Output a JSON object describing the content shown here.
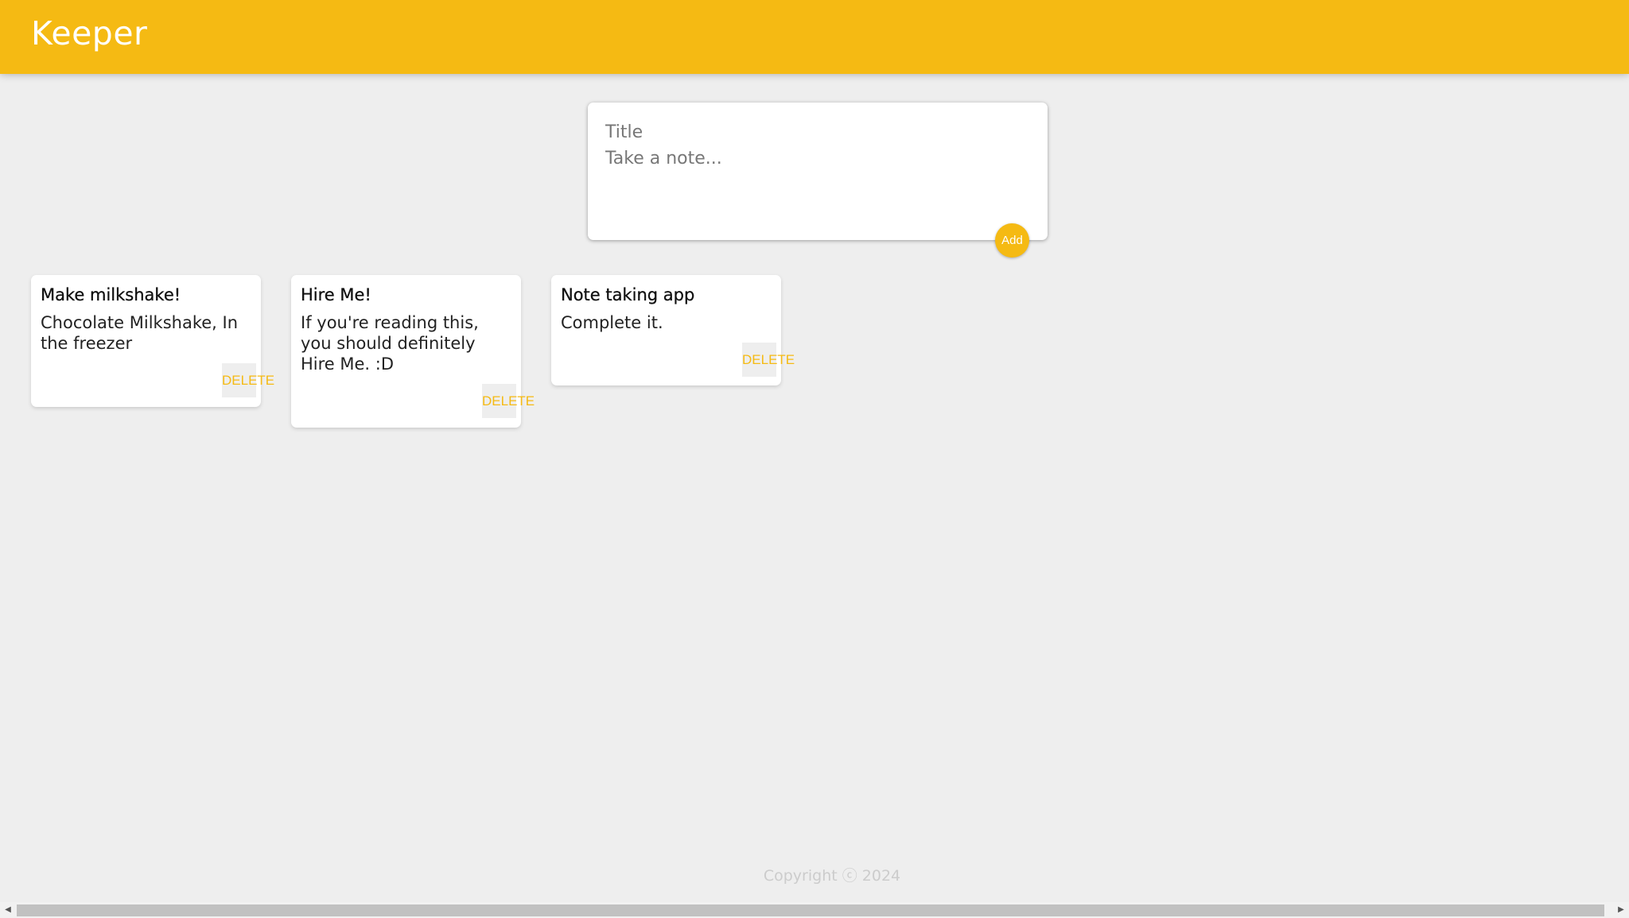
{
  "header": {
    "app_title": "Keeper"
  },
  "composer": {
    "title_placeholder": "Title",
    "content_placeholder": "Take a note...",
    "add_label": "Add"
  },
  "notes": [
    {
      "title": "Make milkshake!",
      "content": "Chocolate Milkshake, In the freezer",
      "delete_label": "DELETE"
    },
    {
      "title": "Hire Me!",
      "content": "If you're reading this, you should definitely Hire Me. :D",
      "delete_label": "DELETE"
    },
    {
      "title": "Note taking app",
      "content": "Complete it.",
      "delete_label": "DELETE"
    }
  ],
  "footer": {
    "copyright": "Copyright ⓒ 2024"
  },
  "colors": {
    "accent": "#f5ba13",
    "background": "#eeeeee"
  },
  "icons": {
    "scroll_left": "scroll-left-arrow-icon",
    "scroll_right": "scroll-right-arrow-icon"
  }
}
